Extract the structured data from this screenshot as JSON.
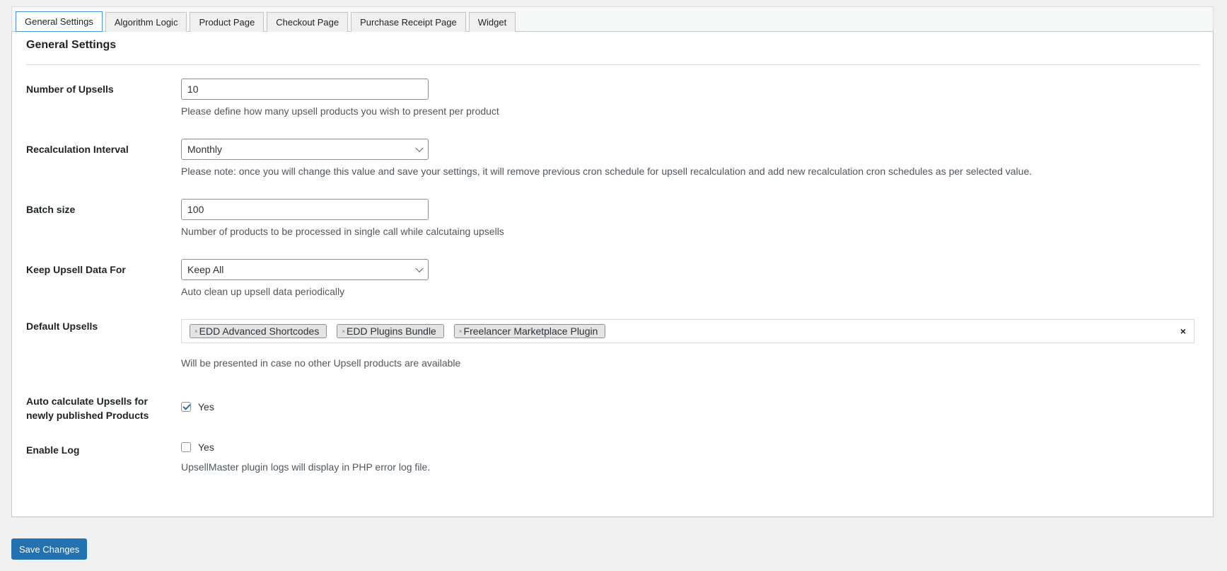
{
  "tabs": [
    {
      "label": "General Settings",
      "active": true
    },
    {
      "label": "Algorithm Logic"
    },
    {
      "label": "Product Page"
    },
    {
      "label": "Checkout Page"
    },
    {
      "label": "Purchase Receipt Page"
    },
    {
      "label": "Widget"
    }
  ],
  "panel": {
    "title": "General Settings"
  },
  "fields": {
    "number_of_upsells": {
      "label": "Number of Upsells",
      "value": "10",
      "description": "Please define how many upsell products you wish to present per product"
    },
    "recalculation_interval": {
      "label": "Recalculation Interval",
      "value": "Monthly",
      "description": "Please note: once you will change this value and save your settings, it will remove previous cron schedule for upsell recalculation and add new recalculation cron schedules as per selected value."
    },
    "batch_size": {
      "label": "Batch size",
      "value": "100",
      "description": "Number of products to be processed in single call while calcutaing upsells"
    },
    "keep_upsell_data_for": {
      "label": "Keep Upsell Data For",
      "value": "Keep All",
      "description": "Auto clean up upsell data periodically"
    },
    "default_upsells": {
      "label": "Default Upsells",
      "chips": [
        "EDD Advanced Shortcodes",
        "EDD Plugins Bundle",
        "Freelancer Marketplace Plugin"
      ],
      "chip_remove_glyph": "×",
      "clear_glyph": "×",
      "description": "Will be presented in case no other Upsell products are available"
    },
    "auto_calculate": {
      "label_line1": "Auto calculate Upsells for",
      "label_line2": "newly published Products",
      "checked": true,
      "checkbox_label": "Yes"
    },
    "enable_log": {
      "label": "Enable Log",
      "checked": false,
      "checkbox_label": "Yes",
      "description": "UpsellMaster plugin logs will display in PHP error log file."
    }
  },
  "save_button": {
    "label": "Save Changes"
  },
  "colors": {
    "primary": "#2271b1",
    "tab_active_border": "#4f94d4",
    "background": "#f0f0f1"
  }
}
